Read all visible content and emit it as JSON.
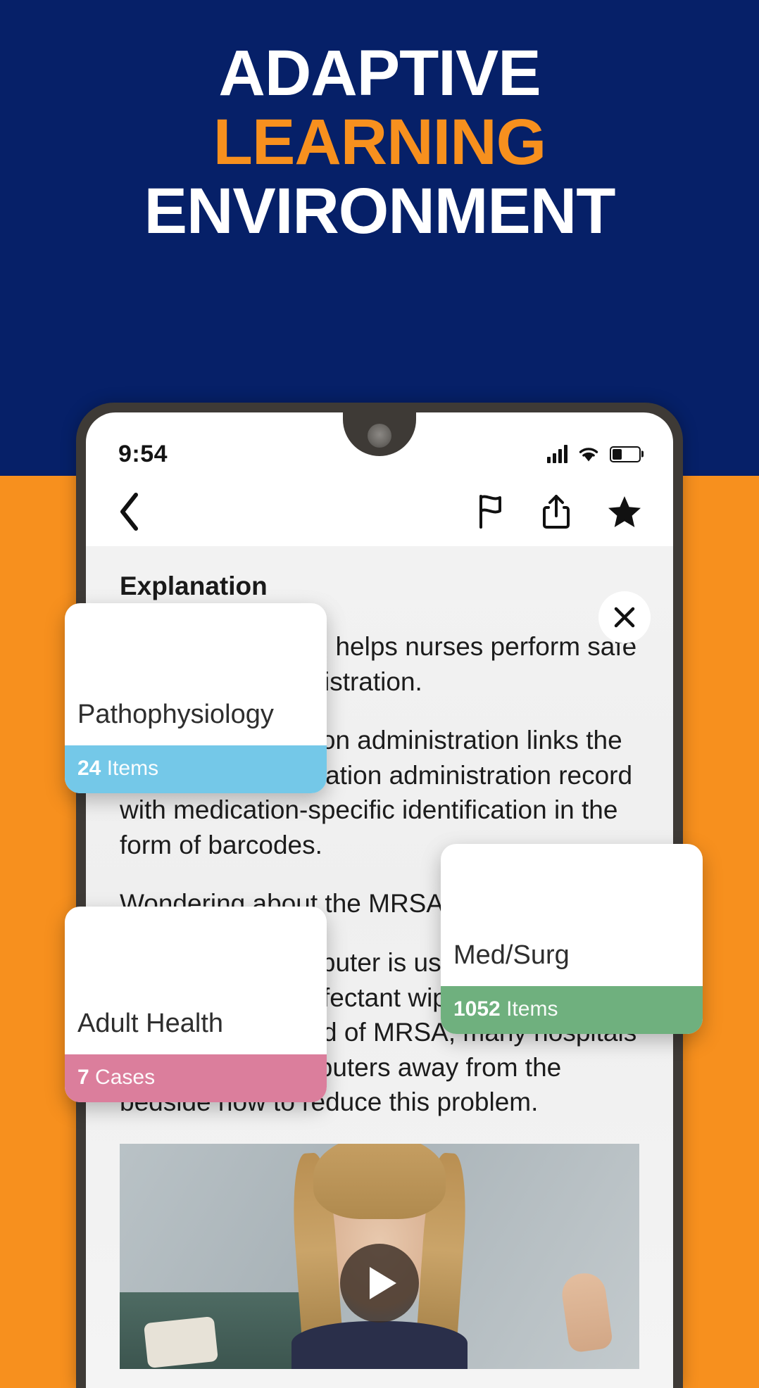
{
  "headline": {
    "line1": "ADAPTIVE",
    "line2": "LEARNING",
    "line3": "ENVIRONMENT",
    "color_white": "#FFFFFF",
    "color_accent": "#F7901E",
    "background": "#062068"
  },
  "background": {
    "top_band": "#062068",
    "bottom_band": "#F7901E"
  },
  "phone": {
    "statusbar": {
      "time": "9:54",
      "signal_icon": "signal-bars-icon",
      "wifi_icon": "wifi-icon",
      "battery_icon": "battery-icon",
      "battery_level_percent": 35
    },
    "toolbar": {
      "back_icon": "chevron-left-icon",
      "flag_icon": "flag-icon",
      "share_icon": "share-icon",
      "star_icon": "star-filled-icon"
    },
    "content": {
      "title": "Explanation",
      "close_icon": "close-icon",
      "paragraphs": [
        "Barcode scanning helps nurses perform safe medication administration.",
        "Barcode medication administration links the patient and medication administration record with medication-specific identification in the form of barcodes.",
        "Wondering about the MRSA connection?",
        "Because the computer is used at the bedside and disinfectant wipes are used to prevent the spread of MRSA, many hospitals have moved computers away from the bedside now to reduce this problem."
      ],
      "video": {
        "play_icon": "play-icon",
        "label": "explanation-video"
      }
    }
  },
  "cards": [
    {
      "title": "Pathophysiology",
      "count": "24",
      "unit": "Items",
      "accent": "#74C8E8"
    },
    {
      "title": "Med/Surg",
      "count": "1052",
      "unit": "Items",
      "accent": "#6FB07E"
    },
    {
      "title": "Adult Health",
      "count": "7",
      "unit": "Cases",
      "accent": "#DB7E9C"
    }
  ]
}
